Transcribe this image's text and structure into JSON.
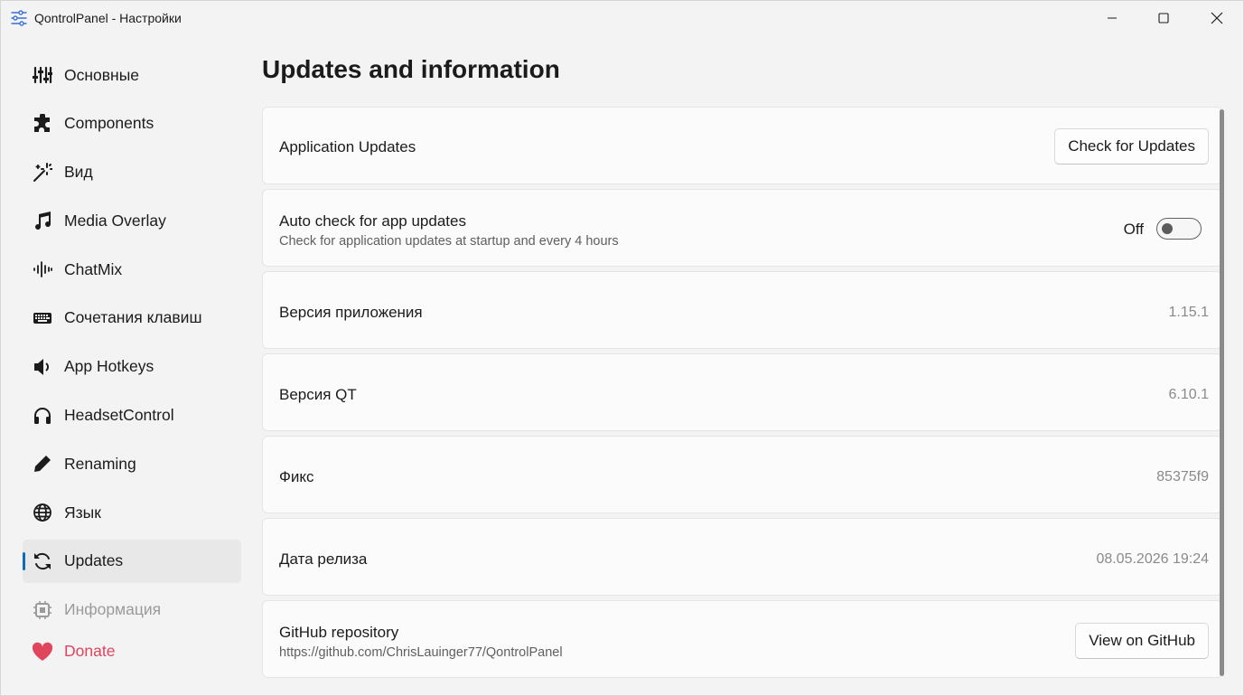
{
  "window": {
    "title": "QontrolPanel - Настройки",
    "controls": {
      "minimize": "minimize-icon",
      "maximize": "maximize-icon",
      "close": "close-icon"
    }
  },
  "sidebar": {
    "items": [
      {
        "label": "Основные",
        "icon": "sliders-icon",
        "state": "normal"
      },
      {
        "label": "Components",
        "icon": "puzzle-icon",
        "state": "normal"
      },
      {
        "label": "Вид",
        "icon": "magic-wand-icon",
        "state": "normal"
      },
      {
        "label": "Media Overlay",
        "icon": "music-note-icon",
        "state": "normal"
      },
      {
        "label": "ChatMix",
        "icon": "waveform-icon",
        "state": "normal"
      },
      {
        "label": "Сочетания клавиш",
        "icon": "keyboard-icon",
        "state": "normal"
      },
      {
        "label": "App Hotkeys",
        "icon": "speaker-icon",
        "state": "normal"
      },
      {
        "label": "HeadsetControl",
        "icon": "headphones-icon",
        "state": "normal"
      },
      {
        "label": "Renaming",
        "icon": "pencil-icon",
        "state": "normal"
      },
      {
        "label": "Язык",
        "icon": "globe-icon",
        "state": "normal"
      },
      {
        "label": "Updates",
        "icon": "refresh-icon",
        "state": "active"
      },
      {
        "label": "Информация",
        "icon": "chip-icon",
        "state": "disabled"
      }
    ],
    "donate": {
      "label": "Donate",
      "icon": "heart-icon"
    }
  },
  "main": {
    "title": "Updates and information",
    "app_updates": {
      "title": "Application Updates",
      "button": "Check for Updates"
    },
    "auto_check": {
      "title": "Auto check for app updates",
      "subtitle": "Check for application updates at startup and every 4 hours",
      "toggle_label": "Off",
      "enabled": false
    },
    "app_version": {
      "title": "Версия приложения",
      "value": "1.15.1"
    },
    "qt_version": {
      "title": "Версия QT",
      "value": "6.10.1"
    },
    "commit": {
      "title": "Фикс",
      "value": "85375f9"
    },
    "release_date": {
      "title": "Дата релиза",
      "value": "08.05.2026 19:24"
    },
    "github": {
      "title": "GitHub repository",
      "subtitle": "https://github.com/ChrisLauinger77/QontrolPanel",
      "button": "View on GitHub"
    }
  },
  "colors": {
    "accent": "#0f6cbd",
    "donate": "#e0455e",
    "background": "#f3f3f3",
    "card": "#fbfbfb"
  }
}
